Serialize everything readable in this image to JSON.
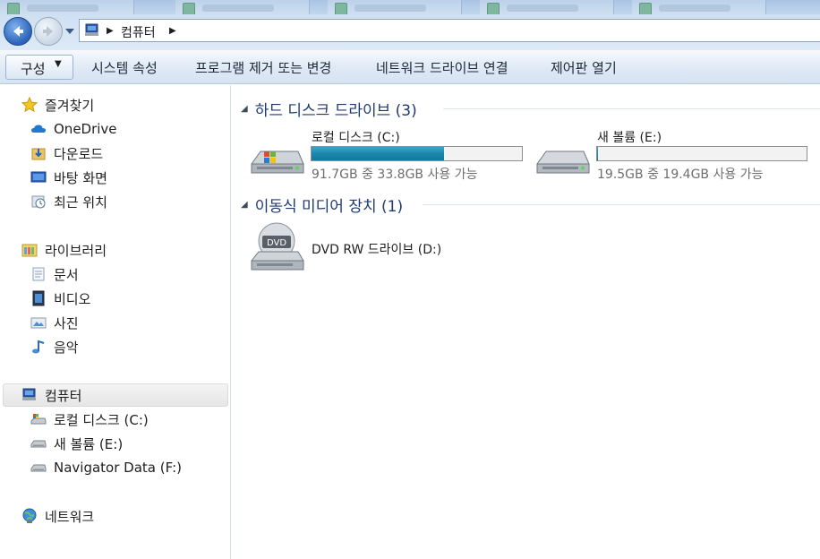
{
  "window": {
    "address_crumbs": [
      "컴퓨터"
    ],
    "icons": {
      "back": "back-arrow-icon",
      "forward": "forward-arrow-icon",
      "history": "chevron-down-icon",
      "address_pc": "computer-icon"
    }
  },
  "toolbar": {
    "organize_label": "구성",
    "commands": [
      "시스템 속성",
      "프로그램 제거 또는 변경",
      "네트워크 드라이브 연결",
      "제어판 열기"
    ]
  },
  "nav": {
    "favorites": {
      "label": "즐겨찾기",
      "items": [
        "OneDrive",
        "다운로드",
        "바탕 화면",
        "최근 위치"
      ]
    },
    "libraries": {
      "label": "라이브러리",
      "items": [
        "문서",
        "비디오",
        "사진",
        "음악"
      ]
    },
    "computer": {
      "label": "컴퓨터",
      "items": [
        "로컬 디스크 (C:)",
        "새 볼륨 (E:)",
        "Navigator Data (F:)"
      ]
    },
    "network": {
      "label": "네트워크"
    }
  },
  "content": {
    "hdd_group": {
      "title": "하드 디스크 드라이브 (3)",
      "drives": [
        {
          "name": "로컬 디스크 (C:)",
          "space": "91.7GB 중 33.8GB 사용 가능",
          "used_fraction": 0.63
        },
        {
          "name": "새 볼륨 (E:)",
          "space": "19.5GB 중 19.4GB 사용 가능",
          "used_fraction": 0.005
        }
      ]
    },
    "removable_group": {
      "title": "이동식 미디어 장치 (1)",
      "drives": [
        {
          "name": "DVD RW 드라이브 (D:)",
          "icon_text": "DVD"
        }
      ]
    }
  },
  "colors": {
    "bar_fill": "#1e86ad",
    "group_title": "#1e3a70",
    "accent_blue": "#2b63b6"
  }
}
